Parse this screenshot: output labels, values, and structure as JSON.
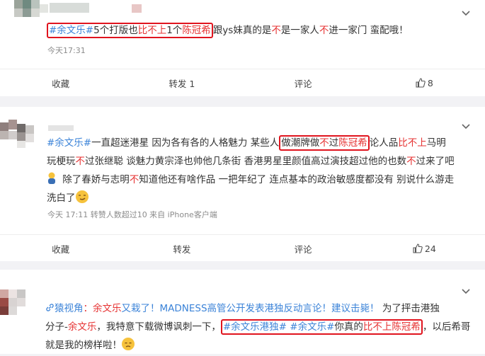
{
  "posts": [
    {
      "segments": [
        {
          "t": "#余文乐#",
          "c": "b",
          "box": "s"
        },
        {
          "t": "5个打版也",
          "c": "k"
        },
        {
          "t": "比不上",
          "c": "r"
        },
        {
          "t": "1个",
          "c": "k"
        },
        {
          "t": "陈冠希",
          "c": "r",
          "box": "e"
        },
        {
          "t": "跟ys妹真的是",
          "c": "k"
        },
        {
          "t": "不",
          "c": "r"
        },
        {
          "t": "是一家人",
          "c": "k"
        },
        {
          "t": "不",
          "c": "r"
        },
        {
          "t": "进一家门 蛮配哦！",
          "c": "k"
        }
      ],
      "meta": "今天17:31",
      "actions": [
        "收藏",
        "转发 1",
        "评论",
        "8"
      ]
    },
    {
      "lines": [
        [
          {
            "t": "#余文乐#",
            "c": "b"
          },
          {
            "t": "一直超迷港星 因为各有各的人格魅力 某些人",
            "c": "k"
          },
          {
            "t": "做潮牌做",
            "c": "k",
            "box": "s"
          },
          {
            "t": "不",
            "c": "r"
          },
          {
            "t": "过",
            "c": "k"
          },
          {
            "t": "陈冠希",
            "c": "r",
            "box": "e"
          },
          {
            "t": "论人品",
            "c": "k"
          },
          {
            "t": "比不上",
            "c": "r"
          },
          {
            "t": "马明",
            "c": "k"
          }
        ],
        [
          {
            "t": "玩梗玩",
            "c": "k"
          },
          {
            "t": "不",
            "c": "r"
          },
          {
            "t": "过张继聪 谈魅力黄宗泽也帅他几条街 香港男星里颜值高过演技超过他的也数",
            "c": "k"
          },
          {
            "t": "不",
            "c": "r"
          },
          {
            "t": "过来了吧",
            "c": "k"
          }
        ],
        [
          {
            "t": "EMOJI_THINK",
            "c": "e"
          },
          {
            "t": " 除了春娇与志明",
            "c": "k"
          },
          {
            "t": "不",
            "c": "r"
          },
          {
            "t": "知道他还有啥作品 一把年纪了 连点基本的政治敏感度都没有 别说什么游走",
            "c": "k"
          }
        ],
        [
          {
            "t": "洗白了",
            "c": "k"
          },
          {
            "t": "EMOJI_SMIRK",
            "c": "e"
          }
        ]
      ],
      "meta": "今天 17:11 转赞人数超过10  来自 iPhone客户端",
      "actions": [
        "收藏",
        "转发",
        "评论",
        "24"
      ]
    },
    {
      "lines": [
        [
          {
            "t": "猿视角",
            "c": "b",
            "link": true
          },
          {
            "t": "：",
            "c": "r"
          },
          {
            "t": "余文乐",
            "c": "r"
          },
          {
            "t": "又栽了！MADNESS高管公开发表港独反动言论！建议击毙！",
            "c": "b"
          },
          {
            "t": "  为了抨击港独",
            "c": "k"
          }
        ],
        [
          {
            "t": "分子-",
            "c": "k"
          },
          {
            "t": "余文乐",
            "c": "r"
          },
          {
            "t": "，我特意下载微博讽刺一下，",
            "c": "k"
          },
          {
            "t": "#余文乐港独#",
            "c": "b",
            "box": "s"
          },
          {
            "t": " ",
            "c": "k"
          },
          {
            "t": "#余文乐#",
            "c": "b"
          },
          {
            "t": "你真的",
            "c": "k"
          },
          {
            "t": "比不上",
            "c": "r"
          },
          {
            "t": "陈冠希",
            "c": "r",
            "box": "e"
          },
          {
            "t": "，以后希哥",
            "c": "k"
          }
        ],
        [
          {
            "t": "就是我的榜样啦！",
            "c": "k"
          },
          {
            "t": "EMOJI_SAD",
            "c": "e"
          }
        ]
      ]
    }
  ],
  "colors": {
    "accent": "#3b83d8",
    "red": "#e63232",
    "box": "#e0141e"
  }
}
